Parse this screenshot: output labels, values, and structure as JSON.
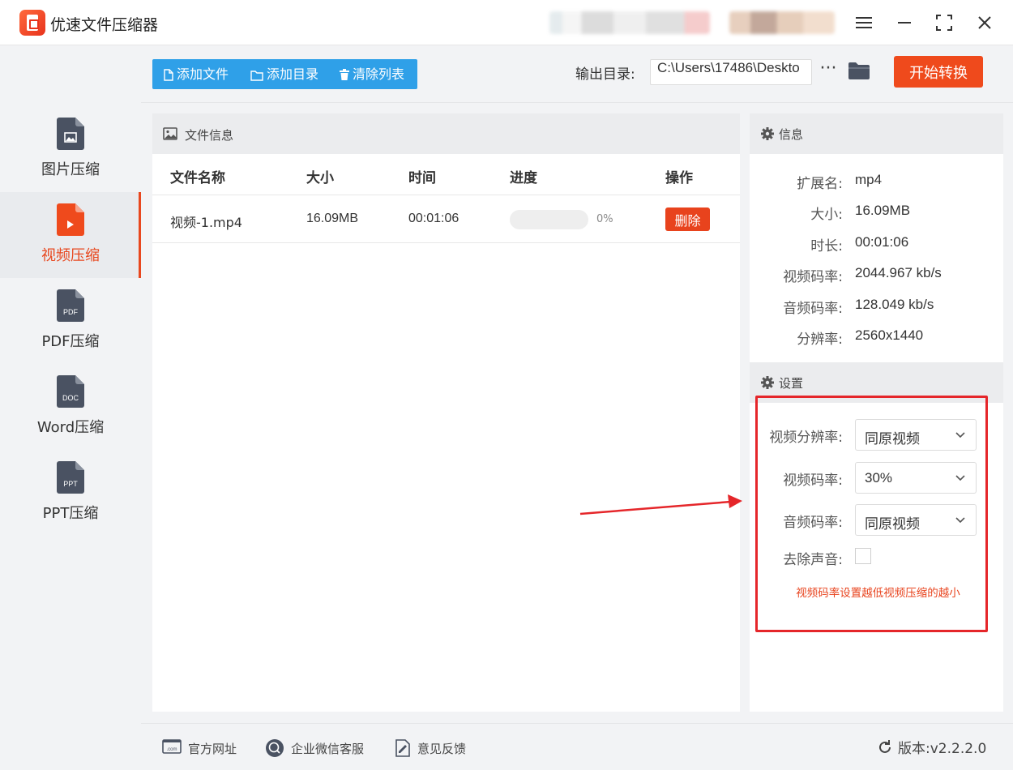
{
  "app": {
    "title": "优速文件压缩器"
  },
  "sidebar": {
    "items": [
      {
        "label": "图片压缩",
        "icon": "image-file-icon",
        "active": false
      },
      {
        "label": "视频压缩",
        "icon": "video-file-icon",
        "active": true
      },
      {
        "label": "PDF压缩",
        "icon": "pdf-file-icon",
        "badge": "PDF",
        "active": false
      },
      {
        "label": "Word压缩",
        "icon": "doc-file-icon",
        "badge": "DOC",
        "active": false
      },
      {
        "label": "PPT压缩",
        "icon": "ppt-file-icon",
        "badge": "PPT",
        "active": false
      }
    ]
  },
  "toolbar": {
    "add_file": "添加文件",
    "add_folder": "添加目录",
    "clear_list": "清除列表",
    "output_label": "输出目录:",
    "output_path": "C:\\Users\\17486\\Deskto",
    "more": "···",
    "start": "开始转换"
  },
  "file_panel": {
    "title": "文件信息",
    "columns": [
      "文件名称",
      "大小",
      "时间",
      "进度",
      "操作"
    ],
    "rows": [
      {
        "name": "视频-1.mp4",
        "size": "16.09MB",
        "duration": "00:01:06",
        "progress": 0,
        "progress_text": "0%",
        "action": "删除"
      }
    ]
  },
  "info_panel": {
    "title": "信息",
    "fields": [
      {
        "key": "扩展名:",
        "value": "mp4"
      },
      {
        "key": "大小:",
        "value": "16.09MB"
      },
      {
        "key": "时长:",
        "value": "00:01:06"
      },
      {
        "key": "视频码率:",
        "value": "2044.967 kb/s"
      },
      {
        "key": "音频码率:",
        "value": "128.049 kb/s"
      },
      {
        "key": "分辨率:",
        "value": "2560x1440"
      }
    ]
  },
  "settings_panel": {
    "title": "设置",
    "video_resolution": {
      "label": "视频分辨率:",
      "value": "同原视频"
    },
    "video_bitrate": {
      "label": "视频码率:",
      "value": "30%"
    },
    "audio_bitrate": {
      "label": "音频码率:",
      "value": "同原视频"
    },
    "remove_audio": {
      "label": "去除声音:",
      "checked": false
    },
    "hint": "视频码率设置越低视频压缩的越小"
  },
  "footer": {
    "website": "官方网址",
    "wechat": "企业微信客服",
    "feedback": "意见反馈",
    "version": "版本:v2.2.2.0"
  },
  "colors": {
    "accent": "#ef4a1c",
    "toolbar_blue": "#2fa0e8",
    "annotation_red": "#e5262a"
  }
}
